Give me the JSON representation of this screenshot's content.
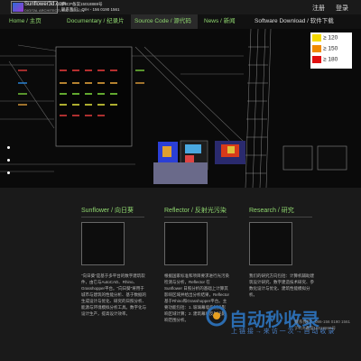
{
  "header": {
    "logo_line1": "Sunflower3d.com",
    "logo_line2": "DIGITAL ARCHITECTURAL DESIGN",
    "icp": "沪ICP备案15018869号",
    "contact": "联系我们：Q/H - 156 0190 1561",
    "register": "注册",
    "login": "登录"
  },
  "nav": {
    "items": [
      {
        "label": "Home / 主页"
      },
      {
        "label": "Documentary / 纪录片"
      },
      {
        "label": "Source Code / 源代码"
      },
      {
        "label": "News / 新闻"
      },
      {
        "label": "Software Download / 软件下载"
      }
    ]
  },
  "legend": {
    "items": [
      {
        "label": "≥ 120",
        "color": "#f5d800"
      },
      {
        "label": "≥ 150",
        "color": "#f08a00"
      },
      {
        "label": "≥ 180",
        "color": "#e01010"
      }
    ]
  },
  "columns": [
    {
      "title": "Sunflower / 向日葵",
      "text": "\"向日葵\"是基于多平台的数字建筑软件，由它与AutoCAD、Rhino、Grasshopper平台。\"向日葵\"将用于城市与建筑的性能分析、基于数据的生成设计与优化、研究的日照分析、能源与环境模拟分析工具。数字化与设计生产，提高设计效率。"
    },
    {
      "title": "Reflector / 反射光污染",
      "text": "根据国家标准和项目要求进行光污染检测与分析，Reflector 在 Sunflower 日照分析的基础上计算其影响区域并给出分析结果，Reflector 基于Rhino和Grasshopper平台。主要功能包括：1. 玻璃幕墙反射光影响区域计算；2. 建筑幕墙反射光影响范围分析。"
    },
    {
      "title": "Research / 研究",
      "text": "我们的研究方向包括：计算机辅助建筑设计研究、数字建造技术研究、参数化设计与优化、建筑性能模拟分析。"
    }
  ],
  "watermark": {
    "main": "自动秒收录",
    "sub": "上 链 接 → 来 访 一 次 → 自 动 收 录"
  },
  "footer": {
    "contact_line1": "联系我们：086-156 0190 1561",
    "contact_line2": "沪ICP备案15018869号"
  }
}
